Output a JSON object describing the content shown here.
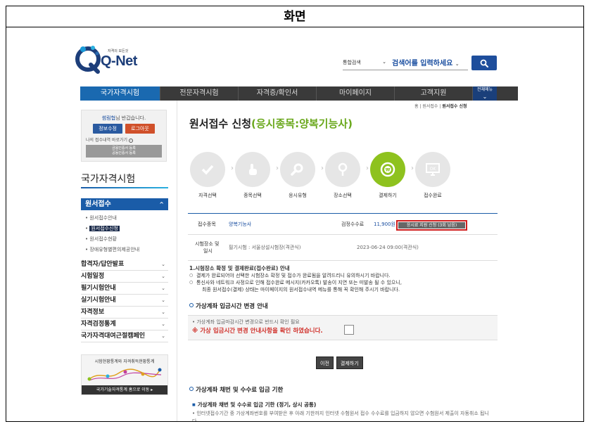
{
  "frame_title": "화면",
  "logo": {
    "brand": "Q-Net",
    "tagline": "자격의 모든것"
  },
  "search": {
    "scope": "통합검색",
    "placeholder": "검색어를 입력하세요"
  },
  "nav": {
    "items": [
      "국가자격시험",
      "전문자격시험",
      "자격증/확인서",
      "마이페이지",
      "고객지원"
    ],
    "all_menu": "전체메뉴"
  },
  "sidebar": {
    "user": "썸림협",
    "welcome_suffix": "님 반갑습니다.",
    "info_btn": "정보수정",
    "logout_btn": "로그아웃",
    "shortcut": "나의 접수내역 바로가기",
    "cert_line1": "금융인증서 등록",
    "cert_line2": "공동인증서 등록",
    "section_title": "국가자격시험",
    "active_menu": "원서접수",
    "sub_items": [
      "원서접수안내",
      "원서접수신청",
      "원서접수현황",
      "장애유형별편의제공안내"
    ],
    "categories": [
      "합격자/답안발표",
      "시험일정",
      "필기시험안내",
      "실기시험안내",
      "자격정보",
      "자격검정통계",
      "국가자격대여근절캠페인"
    ],
    "banner_title": "시험현황통계와 자격취득현황통계",
    "banner_link": "국가기술자격통계 홈으로 이동"
  },
  "breadcrumb": {
    "home": "홈",
    "mid": "원서접수",
    "current": "원서접수 신청"
  },
  "page": {
    "title": "원서접수 신청",
    "subtitle": "(응시종목:양복기능사)"
  },
  "steps": [
    {
      "label": "자격선택",
      "icon": "check-icon"
    },
    {
      "label": "종목선택",
      "icon": "hand-pointer-icon"
    },
    {
      "label": "응시유형",
      "icon": "magnifier-icon"
    },
    {
      "label": "장소선택",
      "icon": "location-pin-icon"
    },
    {
      "label": "결제하기",
      "icon": "won-coin-icon"
    },
    {
      "label": "접수완료",
      "icon": "ok-monitor-icon"
    }
  ],
  "info": {
    "item_key": "접수종목",
    "item_value": "양복기능사",
    "fee_key": "검정수수료",
    "fee_value": "11,900원",
    "fee_btn": "응시료 지원 신청 (3회 남음)",
    "place_key_1": "시험장소 및",
    "place_key_2": "일시",
    "place_value": "필기시험 : 서울상설시험장(격관식)",
    "date_value": "2023-06-24 09:00(격관식)"
  },
  "notice": {
    "heading": "1.시험장소 확정 및 결제완료(접수완료) 안내",
    "li1": "결제가 완료되어야 선택한 시험장소 확정 및 접수가 완료됨을 알려드리니 유의하시기 바랍니다.",
    "li2": "통신사와 네트워크 사정으로 인해 접수완료 메시지(카카오톡) 발송이 지연 또는 미발송 될 수 있으니,",
    "li2_cont": "최종 원서접수(결제) 상태는 마이페이지의 원서접수내역 메뉴를 통해 꼭 확인해 주시기 바랍니다."
  },
  "vbank": {
    "heading": "가상계좌 입금시간 변경 안내",
    "line1": "• 가상계좌 입금마감시간 변경으로 반드시 확인 필요",
    "line2": "※ 가상 입금시간 변경 안내사항을 확인 하였습니다."
  },
  "buttons": {
    "prev": "이전",
    "pay": "결제하기"
  },
  "account": {
    "heading": "가상계좌 채번 및 수수료 입금 기한",
    "sub_heading": "가상계좌 채번 및 수수료 입금 기한 (정기, 상시 공통)",
    "para": "• 인터넷접수기간 중 가상계좌번호를 부여받은 후 아래 기한까지 인터넷 수험원서 접수 수수료를 입금하지 않으면 수험원서 제출이 자동취소 됩니다."
  }
}
